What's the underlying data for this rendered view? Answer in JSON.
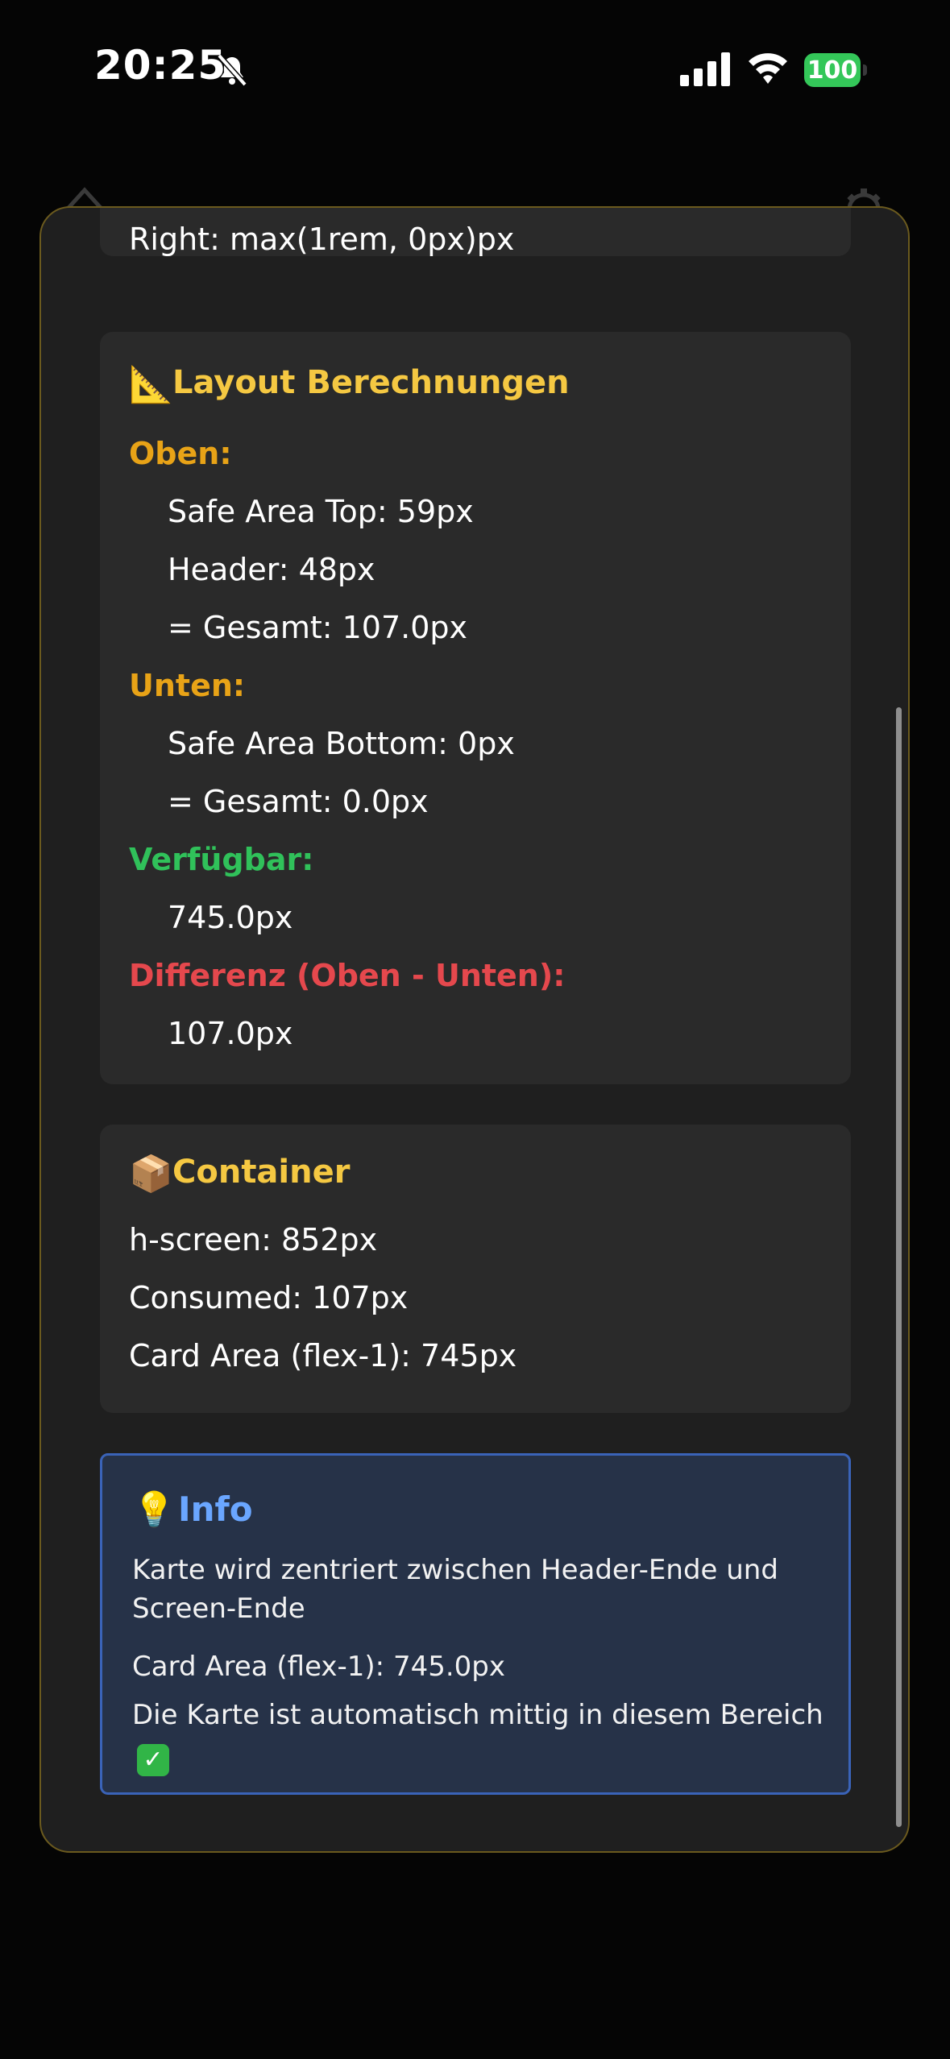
{
  "status_bar": {
    "time": "20:25",
    "battery": "100"
  },
  "prev_card": {
    "right_line": "Right: max(1rem, 0px)px"
  },
  "layout_card": {
    "emoji": "📐",
    "title": "Layout Berechnungen",
    "top_label": "Oben:",
    "top_lines": [
      "Safe Area Top: 59px",
      "Header: 48px",
      "= Gesamt: 107.0px"
    ],
    "bottom_label": "Unten:",
    "bottom_lines": [
      "Safe Area Bottom: 0px",
      "= Gesamt: 0.0px"
    ],
    "available_label": "Verfügbar:",
    "available_value": "745.0px",
    "diff_label": "Differenz (Oben - Unten):",
    "diff_value": "107.0px"
  },
  "container_card": {
    "emoji": "📦",
    "title": "Container",
    "lines": [
      "h-screen: 852px",
      "Consumed: 107px",
      "Card Area (flex-1): 745px"
    ]
  },
  "info_box": {
    "emoji": "💡",
    "title": "Info",
    "line1": "Karte wird zentriert zwischen Header-Ende und Screen-Ende",
    "line2": "Card Area (flex-1): 745.0px",
    "line3": "Die Karte ist automatisch mittig in diesem Bereich",
    "check": "✓"
  },
  "colors": {
    "accent_yellow": "#f5c842",
    "label_orange": "#e8a317",
    "label_green": "#30c15a",
    "label_red": "#e5484d",
    "info_blue": "#6aa6ff"
  }
}
